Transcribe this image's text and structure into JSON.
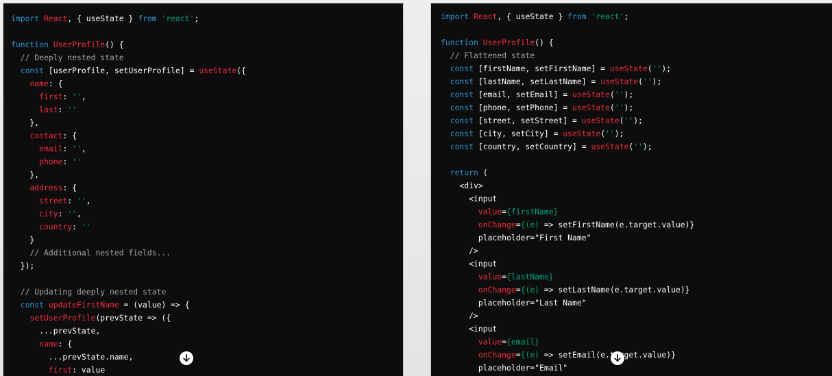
{
  "left_panel": {
    "lines": [
      [
        {
          "t": "import ",
          "c": "kw"
        },
        {
          "t": "React",
          "c": "fn"
        },
        {
          "t": ", { useState } ",
          "c": "tx"
        },
        {
          "t": "from",
          "c": "kw"
        },
        {
          "t": " ",
          "c": "tx"
        },
        {
          "t": "'react'",
          "c": "str"
        },
        {
          "t": ";",
          "c": "tx"
        }
      ],
      [],
      [
        {
          "t": "function ",
          "c": "kw"
        },
        {
          "t": "UserProfile",
          "c": "fn"
        },
        {
          "t": "() {",
          "c": "tx"
        }
      ],
      [
        {
          "t": "  // Deeply nested state",
          "c": "cm"
        }
      ],
      [
        {
          "t": "  ",
          "c": "tx"
        },
        {
          "t": "const",
          "c": "kw"
        },
        {
          "t": " [userProfile, setUserProfile] = ",
          "c": "tx"
        },
        {
          "t": "useState",
          "c": "fn"
        },
        {
          "t": "({",
          "c": "tx"
        }
      ],
      [
        {
          "t": "    ",
          "c": "tx"
        },
        {
          "t": "name",
          "c": "fn"
        },
        {
          "t": ": {",
          "c": "tx"
        }
      ],
      [
        {
          "t": "      ",
          "c": "tx"
        },
        {
          "t": "first",
          "c": "fn"
        },
        {
          "t": ": ",
          "c": "tx"
        },
        {
          "t": "''",
          "c": "str"
        },
        {
          "t": ",",
          "c": "tx"
        }
      ],
      [
        {
          "t": "      ",
          "c": "tx"
        },
        {
          "t": "last",
          "c": "fn"
        },
        {
          "t": ": ",
          "c": "tx"
        },
        {
          "t": "''",
          "c": "str"
        }
      ],
      [
        {
          "t": "    },",
          "c": "tx"
        }
      ],
      [
        {
          "t": "    ",
          "c": "tx"
        },
        {
          "t": "contact",
          "c": "fn"
        },
        {
          "t": ": {",
          "c": "tx"
        }
      ],
      [
        {
          "t": "      ",
          "c": "tx"
        },
        {
          "t": "email",
          "c": "fn"
        },
        {
          "t": ": ",
          "c": "tx"
        },
        {
          "t": "''",
          "c": "str"
        },
        {
          "t": ",",
          "c": "tx"
        }
      ],
      [
        {
          "t": "      ",
          "c": "tx"
        },
        {
          "t": "phone",
          "c": "fn"
        },
        {
          "t": ": ",
          "c": "tx"
        },
        {
          "t": "''",
          "c": "str"
        }
      ],
      [
        {
          "t": "    },",
          "c": "tx"
        }
      ],
      [
        {
          "t": "    ",
          "c": "tx"
        },
        {
          "t": "address",
          "c": "fn"
        },
        {
          "t": ": {",
          "c": "tx"
        }
      ],
      [
        {
          "t": "      ",
          "c": "tx"
        },
        {
          "t": "street",
          "c": "fn"
        },
        {
          "t": ": ",
          "c": "tx"
        },
        {
          "t": "''",
          "c": "str"
        },
        {
          "t": ",",
          "c": "tx"
        }
      ],
      [
        {
          "t": "      ",
          "c": "tx"
        },
        {
          "t": "city",
          "c": "fn"
        },
        {
          "t": ": ",
          "c": "tx"
        },
        {
          "t": "''",
          "c": "str"
        },
        {
          "t": ",",
          "c": "tx"
        }
      ],
      [
        {
          "t": "      ",
          "c": "tx"
        },
        {
          "t": "country",
          "c": "fn"
        },
        {
          "t": ": ",
          "c": "tx"
        },
        {
          "t": "''",
          "c": "str"
        }
      ],
      [
        {
          "t": "    }",
          "c": "tx"
        }
      ],
      [
        {
          "t": "    // Additional nested fields...",
          "c": "cm"
        }
      ],
      [
        {
          "t": "  });",
          "c": "tx"
        }
      ],
      [],
      [
        {
          "t": "  // Updating deeply nested state",
          "c": "cm"
        }
      ],
      [
        {
          "t": "  ",
          "c": "tx"
        },
        {
          "t": "const",
          "c": "kw"
        },
        {
          "t": " ",
          "c": "tx"
        },
        {
          "t": "updateFirstName",
          "c": "fn"
        },
        {
          "t": " = (value) => {",
          "c": "tx"
        }
      ],
      [
        {
          "t": "    ",
          "c": "tx"
        },
        {
          "t": "setUserProfile",
          "c": "fn"
        },
        {
          "t": "(prevState => ({",
          "c": "tx"
        }
      ],
      [
        {
          "t": "      ...prevState,",
          "c": "tx"
        }
      ],
      [
        {
          "t": "      ",
          "c": "tx"
        },
        {
          "t": "name",
          "c": "fn"
        },
        {
          "t": ": {",
          "c": "tx"
        }
      ],
      [
        {
          "t": "        ...prevState.name,",
          "c": "tx"
        }
      ],
      [
        {
          "t": "        ",
          "c": "tx"
        },
        {
          "t": "first",
          "c": "fn"
        },
        {
          "t": ": value",
          "c": "tx"
        }
      ]
    ]
  },
  "right_panel": {
    "lines": [
      [
        {
          "t": "import ",
          "c": "kw"
        },
        {
          "t": "React",
          "c": "fn"
        },
        {
          "t": ", { useState } ",
          "c": "tx"
        },
        {
          "t": "from",
          "c": "kw"
        },
        {
          "t": " ",
          "c": "tx"
        },
        {
          "t": "'react'",
          "c": "str"
        },
        {
          "t": ";",
          "c": "tx"
        }
      ],
      [],
      [
        {
          "t": "function ",
          "c": "kw"
        },
        {
          "t": "UserProfile",
          "c": "fn"
        },
        {
          "t": "() {",
          "c": "tx"
        }
      ],
      [
        {
          "t": "  // Flattened state",
          "c": "cm"
        }
      ],
      [
        {
          "t": "  ",
          "c": "tx"
        },
        {
          "t": "const",
          "c": "kw"
        },
        {
          "t": " [firstName, setFirstName] = ",
          "c": "tx"
        },
        {
          "t": "useState",
          "c": "fn"
        },
        {
          "t": "(",
          "c": "tx"
        },
        {
          "t": "''",
          "c": "str"
        },
        {
          "t": ");",
          "c": "tx"
        }
      ],
      [
        {
          "t": "  ",
          "c": "tx"
        },
        {
          "t": "const",
          "c": "kw"
        },
        {
          "t": " [lastName, setLastName] = ",
          "c": "tx"
        },
        {
          "t": "useState",
          "c": "fn"
        },
        {
          "t": "(",
          "c": "tx"
        },
        {
          "t": "''",
          "c": "str"
        },
        {
          "t": ");",
          "c": "tx"
        }
      ],
      [
        {
          "t": "  ",
          "c": "tx"
        },
        {
          "t": "const",
          "c": "kw"
        },
        {
          "t": " [email, setEmail] = ",
          "c": "tx"
        },
        {
          "t": "useState",
          "c": "fn"
        },
        {
          "t": "(",
          "c": "tx"
        },
        {
          "t": "''",
          "c": "str"
        },
        {
          "t": ");",
          "c": "tx"
        }
      ],
      [
        {
          "t": "  ",
          "c": "tx"
        },
        {
          "t": "const",
          "c": "kw"
        },
        {
          "t": " [phone, setPhone] = ",
          "c": "tx"
        },
        {
          "t": "useState",
          "c": "fn"
        },
        {
          "t": "(",
          "c": "tx"
        },
        {
          "t": "''",
          "c": "str"
        },
        {
          "t": ");",
          "c": "tx"
        }
      ],
      [
        {
          "t": "  ",
          "c": "tx"
        },
        {
          "t": "const",
          "c": "kw"
        },
        {
          "t": " [street, setStreet] = ",
          "c": "tx"
        },
        {
          "t": "useState",
          "c": "fn"
        },
        {
          "t": "(",
          "c": "tx"
        },
        {
          "t": "''",
          "c": "str"
        },
        {
          "t": ");",
          "c": "tx"
        }
      ],
      [
        {
          "t": "  ",
          "c": "tx"
        },
        {
          "t": "const",
          "c": "kw"
        },
        {
          "t": " [city, setCity] = ",
          "c": "tx"
        },
        {
          "t": "useState",
          "c": "fn"
        },
        {
          "t": "(",
          "c": "tx"
        },
        {
          "t": "''",
          "c": "str"
        },
        {
          "t": ");",
          "c": "tx"
        }
      ],
      [
        {
          "t": "  ",
          "c": "tx"
        },
        {
          "t": "const",
          "c": "kw"
        },
        {
          "t": " [country, setCountry] = ",
          "c": "tx"
        },
        {
          "t": "useState",
          "c": "fn"
        },
        {
          "t": "(",
          "c": "tx"
        },
        {
          "t": "''",
          "c": "str"
        },
        {
          "t": ");",
          "c": "tx"
        }
      ],
      [],
      [
        {
          "t": "  ",
          "c": "tx"
        },
        {
          "t": "return",
          "c": "kw"
        },
        {
          "t": " (",
          "c": "tx"
        }
      ],
      [
        {
          "t": "    <div>",
          "c": "tx"
        }
      ],
      [
        {
          "t": "      <input",
          "c": "tx"
        }
      ],
      [
        {
          "t": "        ",
          "c": "tx"
        },
        {
          "t": "value",
          "c": "fn"
        },
        {
          "t": "=",
          "c": "tx"
        },
        {
          "t": "{firstName}",
          "c": "str"
        }
      ],
      [
        {
          "t": "        ",
          "c": "tx"
        },
        {
          "t": "onChange",
          "c": "fn"
        },
        {
          "t": "=",
          "c": "tx"
        },
        {
          "t": "{(e)",
          "c": "str"
        },
        {
          "t": " => setFirstName(e.target.value)}",
          "c": "tx"
        }
      ],
      [
        {
          "t": "        placeholder=\"First Name\"",
          "c": "tx"
        }
      ],
      [
        {
          "t": "      />",
          "c": "tx"
        }
      ],
      [
        {
          "t": "      <input",
          "c": "tx"
        }
      ],
      [
        {
          "t": "        ",
          "c": "tx"
        },
        {
          "t": "value",
          "c": "fn"
        },
        {
          "t": "=",
          "c": "tx"
        },
        {
          "t": "{lastName}",
          "c": "str"
        }
      ],
      [
        {
          "t": "        ",
          "c": "tx"
        },
        {
          "t": "onChange",
          "c": "fn"
        },
        {
          "t": "=",
          "c": "tx"
        },
        {
          "t": "{(e)",
          "c": "str"
        },
        {
          "t": " => setLastName(e.target.value)}",
          "c": "tx"
        }
      ],
      [
        {
          "t": "        placeholder=\"Last Name\"",
          "c": "tx"
        }
      ],
      [
        {
          "t": "      />",
          "c": "tx"
        }
      ],
      [
        {
          "t": "      <input",
          "c": "tx"
        }
      ],
      [
        {
          "t": "        ",
          "c": "tx"
        },
        {
          "t": "value",
          "c": "fn"
        },
        {
          "t": "=",
          "c": "tx"
        },
        {
          "t": "{email}",
          "c": "str"
        }
      ],
      [
        {
          "t": "        ",
          "c": "tx"
        },
        {
          "t": "onChange",
          "c": "fn"
        },
        {
          "t": "=",
          "c": "tx"
        },
        {
          "t": "{(e)",
          "c": "str"
        },
        {
          "t": " => setEmail(e.target.value)}",
          "c": "tx"
        }
      ],
      [
        {
          "t": "        placeholder=\"Email\"",
          "c": "tx"
        }
      ],
      [
        {
          "t": "      />",
          "c": "tx"
        }
      ]
    ]
  },
  "scroll_button_icon": "arrow-down-circle-icon",
  "colors": {
    "keyword": "#2e95d3",
    "function_name": "#f22c3d",
    "string": "#00a67d",
    "comment": "#a4a4a4",
    "code_background": "#0d0d0d"
  }
}
